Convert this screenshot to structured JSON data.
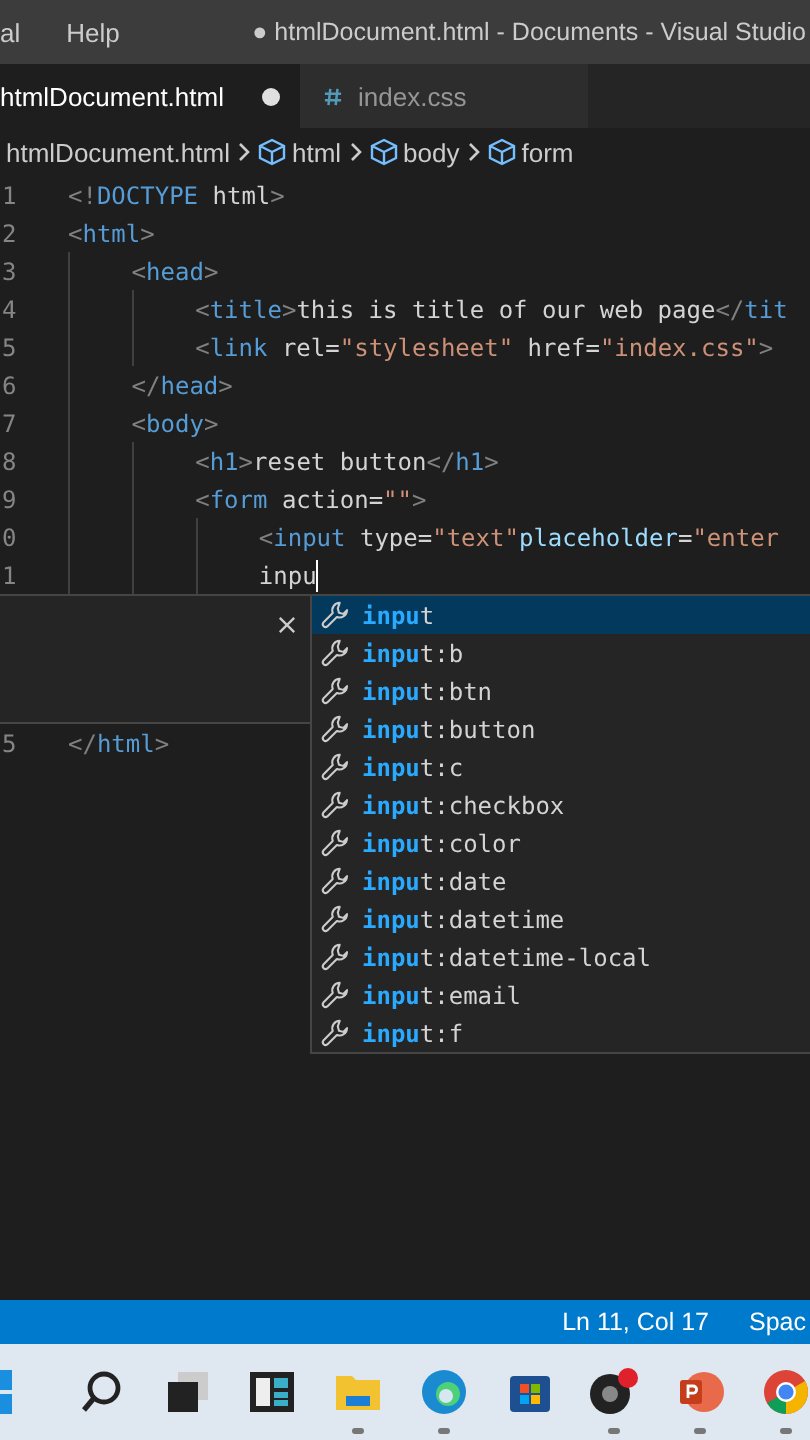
{
  "menu": [
    "al",
    "Help"
  ],
  "window": {
    "title": "● htmlDocument.html - Documents - Visual Studio"
  },
  "tabs": [
    {
      "label": "htmlDocument.html",
      "selected": true,
      "modified": true,
      "kind": "html"
    },
    {
      "label": "index.css",
      "selected": false,
      "modified": false,
      "kind": "css"
    }
  ],
  "breadcrumb": [
    {
      "label": "htmlDocument.html",
      "kind": "file"
    },
    {
      "label": "html",
      "kind": "element"
    },
    {
      "label": "body",
      "kind": "element"
    },
    {
      "label": "form",
      "kind": "element"
    }
  ],
  "code": [
    {
      "number": "1",
      "text": "<!DOCTYPE html>"
    },
    {
      "number": "2",
      "text": "<html>",
      "children": [
        {
          "number": "3",
          "text": "<head>",
          "children": [
            {
              "number": "4",
              "text": "<title>this is title of our web page</tit"
            },
            {
              "number": "5",
              "text": "<link rel=\"stylesheet\" href=\"index.css\">"
            }
          ]
        },
        {
          "number": "6",
          "text": "</head>"
        },
        {
          "number": "7",
          "text": "<body>",
          "children": [
            {
              "number": "8",
              "text": "<h1>reset button</h1>"
            },
            {
              "number": "9",
              "text": "<form action=\"\">",
              "children": [
                {
                  "number": "0",
                  "text": "<input type=\"text\"placeholder=\"enter"
                },
                {
                  "number": "1",
                  "text": "inpu"
                }
              ]
            }
          ]
        }
      ]
    }
  ],
  "code_after": [
    {
      "number": "5",
      "text": "</html>"
    }
  ],
  "suggestions": [
    {
      "label": "**inpu**t",
      "selected": true
    },
    {
      "label": "**inpu**t:b",
      "selected": false
    },
    {
      "label": "**inpu**t:btn",
      "selected": false
    },
    {
      "label": "**inpu**t:button",
      "selected": false
    },
    {
      "label": "**inpu**t:c",
      "selected": false
    },
    {
      "label": "**inpu**t:checkbox",
      "selected": false
    },
    {
      "label": "**inpu**t:color",
      "selected": false
    },
    {
      "label": "**inpu**t:date",
      "selected": false
    },
    {
      "label": "**inpu**t:datetime",
      "selected": false
    },
    {
      "label": "**inpu**t:datetime-local",
      "selected": false
    },
    {
      "label": "**inpu**t:email",
      "selected": false
    },
    {
      "label": "**inpu**t:f",
      "selected": false
    }
  ],
  "status_bar": {
    "position": "Ln 11, Col 17",
    "indent": "Spac"
  },
  "taskbar": [
    {
      "kind": "start"
    },
    {
      "kind": "search"
    },
    {
      "kind": "taskview"
    },
    {
      "kind": "widgets"
    },
    {
      "kind": "explorer",
      "running": true
    },
    {
      "kind": "edge",
      "running": true
    },
    {
      "kind": "store",
      "running": false
    },
    {
      "kind": "obs",
      "running": true
    },
    {
      "kind": "powerpoint",
      "running": true
    },
    {
      "kind": "chrome",
      "running": true
    }
  ]
}
